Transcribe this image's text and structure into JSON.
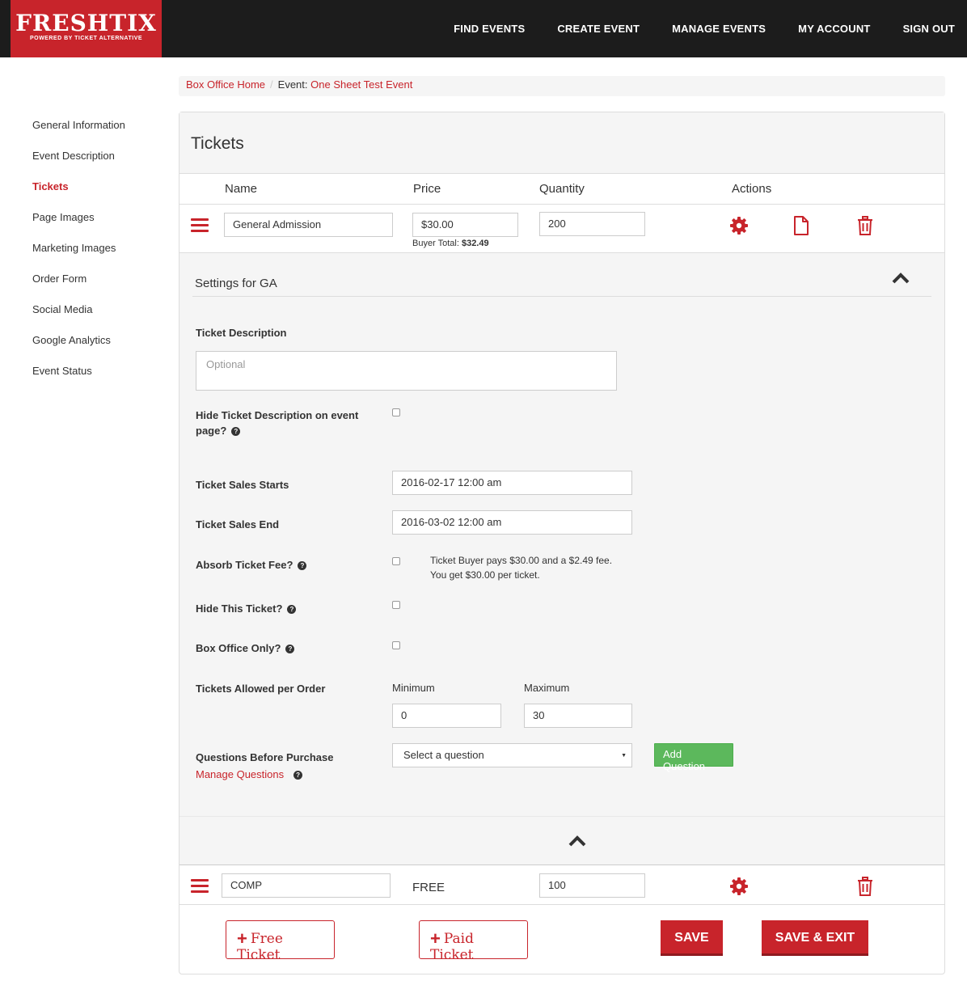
{
  "header": {
    "logo_main": "FRESHTIX",
    "logo_sub": "POWERED BY TICKET ALTERNATIVE",
    "nav": [
      "FIND EVENTS",
      "CREATE EVENT",
      "MANAGE EVENTS",
      "MY ACCOUNT",
      "SIGN OUT"
    ]
  },
  "sidebar": {
    "items": [
      "General Information",
      "Event Description",
      "Tickets",
      "Page Images",
      "Marketing Images",
      "Order Form",
      "Social Media",
      "Google Analytics",
      "Event Status"
    ],
    "active": "Tickets"
  },
  "breadcrumb": {
    "home": "Box Office Home",
    "event_prefix": "Event:",
    "event_name": "One Sheet Test Event"
  },
  "panel": {
    "title": "Tickets",
    "columns": {
      "name": "Name",
      "price": "Price",
      "quantity": "Quantity",
      "actions": "Actions"
    }
  },
  "tickets": [
    {
      "name": "General Admission",
      "price": "$30.00",
      "buyer_total_label": "Buyer Total:",
      "buyer_total": "$32.49",
      "quantity": "200"
    },
    {
      "name": "COMP",
      "price": "FREE",
      "quantity": "100"
    }
  ],
  "settings": {
    "title": "Settings for GA",
    "description_label": "Ticket Description",
    "description_placeholder": "Optional",
    "hide_desc_label_1": "Hide Ticket Description on event",
    "hide_desc_label_2": "page?",
    "sales_start_label": "Ticket Sales Starts",
    "sales_start_value": "2016-02-17 12:00 am",
    "sales_end_label": "Ticket Sales End",
    "sales_end_value": "2016-03-02 12:00 am",
    "absorb_fee_label": "Absorb Ticket Fee?",
    "absorb_fee_note_1": "Ticket Buyer pays $30.00 and a $2.49 fee.",
    "absorb_fee_note_2": "You get $30.00 per ticket.",
    "hide_ticket_label": "Hide This Ticket?",
    "box_office_label": "Box Office Only?",
    "allowed_label": "Tickets Allowed per Order",
    "minimum_label": "Minimum",
    "minimum_value": "0",
    "maximum_label": "Maximum",
    "maximum_value": "30",
    "questions_label": "Questions Before Purchase",
    "manage_questions": "Manage Questions",
    "select_question": "Select a question",
    "add_question": "Add Question"
  },
  "footer_buttons": {
    "free_ticket": "Free Ticket",
    "paid_ticket": "Paid Ticket",
    "save": "SAVE",
    "save_exit": "SAVE & EXIT"
  },
  "colors": {
    "brand_red": "#c8242b",
    "header_bg": "#1c1c1c",
    "green": "#5cb85c"
  }
}
